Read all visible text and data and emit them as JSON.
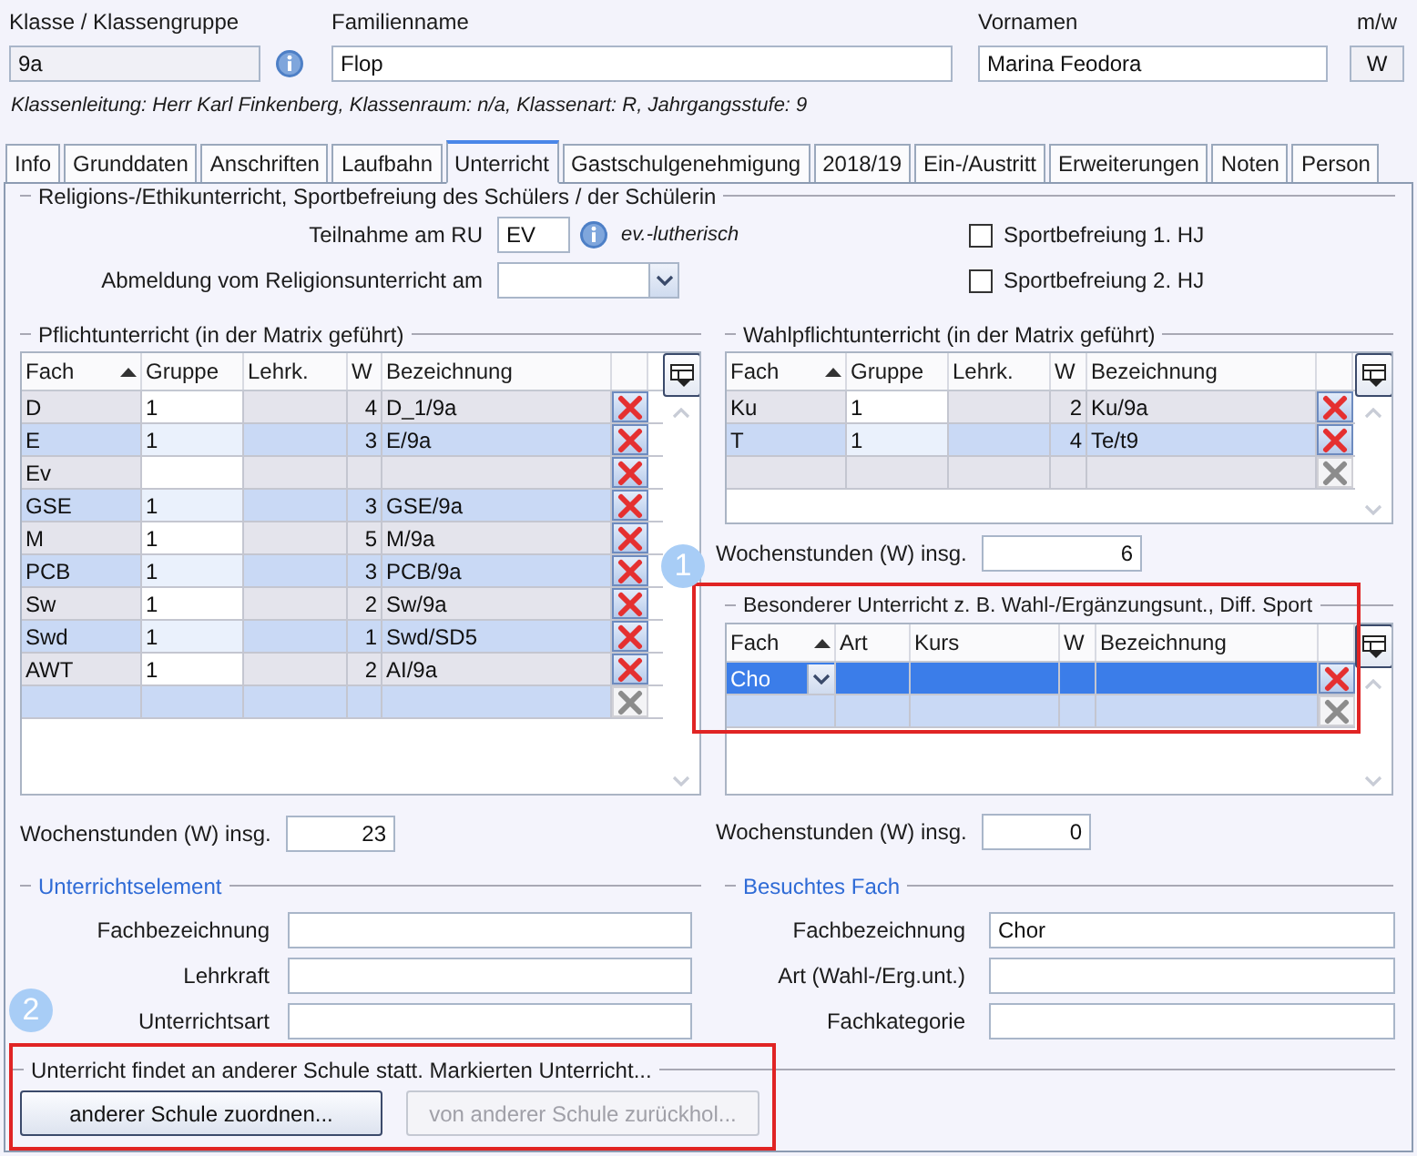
{
  "header": {
    "class_label": "Klasse / Klassengruppe",
    "class_value": "9a",
    "family_label": "Familienname",
    "family_value": "Flop",
    "first_label": "Vornamen",
    "first_value": "Marina Feodora",
    "gender_label": "m/w",
    "gender_value": "W",
    "info": "Klassenleitung: Herr Karl Finkenberg, Klassenraum: n/a, Klassenart: R, Jahrgangsstufe: 9"
  },
  "tabs": [
    {
      "label": "Info",
      "selected": false
    },
    {
      "label": "Grunddaten",
      "selected": false
    },
    {
      "label": "Anschriften",
      "selected": false
    },
    {
      "label": "Laufbahn",
      "selected": false
    },
    {
      "label": "Unterricht",
      "selected": true
    },
    {
      "label": "Gastschulgenehmigung",
      "selected": false
    },
    {
      "label": "2018/19",
      "selected": false
    },
    {
      "label": "Ein-/Austritt",
      "selected": false
    },
    {
      "label": "Erweiterungen",
      "selected": false
    },
    {
      "label": "Noten",
      "selected": false
    },
    {
      "label": "Person",
      "selected": false
    }
  ],
  "religion": {
    "title": "Religions-/Ethikunterricht, Sportbefreiung des Schülers / der Schülerin",
    "ru_label": "Teilnahme am RU",
    "ru_value": "EV",
    "ru_note": "ev.-lutherisch",
    "abmeldung_label": "Abmeldung vom Religionsunterricht am",
    "checkboxes": [
      {
        "label": "Sportbefreiung 1. HJ",
        "checked": false
      },
      {
        "label": "Sportbefreiung 2. HJ",
        "checked": false
      }
    ]
  },
  "pflicht": {
    "title": "Pflichtunterricht (in der Matrix geführt)",
    "columns": [
      "Fach",
      "Gruppe",
      "Lehrk.",
      "W",
      "Bezeichnung"
    ],
    "rows": [
      {
        "kind": "entry",
        "selected": false,
        "fach": "D",
        "gruppe": "1",
        "w": "4",
        "bezeichnung": "D_1/9a"
      },
      {
        "kind": "entry",
        "selected": false,
        "fach": "E",
        "gruppe": "1",
        "w": "3",
        "bezeichnung": "E/9a"
      },
      {
        "kind": "entry",
        "selected": false,
        "fach": "Ev"
      },
      {
        "kind": "entry",
        "selected": false,
        "fach": "GSE",
        "gruppe": "1",
        "w": "3",
        "bezeichnung": "GSE/9a"
      },
      {
        "kind": "entry",
        "selected": false,
        "fach": "M",
        "gruppe": "1",
        "w": "5",
        "bezeichnung": "M/9a"
      },
      {
        "kind": "entry",
        "selected": false,
        "fach": "PCB",
        "gruppe": "1",
        "w": "3",
        "bezeichnung": "PCB/9a"
      },
      {
        "kind": "entry",
        "selected": false,
        "fach": "Sw",
        "gruppe": "1",
        "w": "2",
        "bezeichnung": "Sw/9a"
      },
      {
        "kind": "entry",
        "selected": false,
        "fach": "Swd",
        "gruppe": "1",
        "w": "1",
        "bezeichnung": "Swd/SD5"
      },
      {
        "kind": "entry",
        "selected": false,
        "fach": "AWT",
        "gruppe": "1",
        "w": "2",
        "bezeichnung": "AI/9a"
      },
      {
        "kind": "new",
        "selected": false
      }
    ],
    "total_label": "Wochenstunden (W) insg.",
    "total": "23"
  },
  "wahlpflicht": {
    "title": "Wahlpflichtunterricht (in der Matrix geführt)",
    "columns": [
      "Fach",
      "Gruppe",
      "Lehrk.",
      "W",
      "Bezeichnung"
    ],
    "rows": [
      {
        "kind": "entry",
        "selected": false,
        "fach": "Ku",
        "gruppe": "1",
        "w": "2",
        "bezeichnung": "Ku/9a"
      },
      {
        "kind": "entry",
        "selected": false,
        "fach": "T",
        "gruppe": "1",
        "w": "4",
        "bezeichnung": "Te/t9"
      },
      {
        "kind": "new",
        "selected": false
      }
    ],
    "total_label": "Wochenstunden (W) insg.",
    "total": "6"
  },
  "besonderer": {
    "title": "Besonderer Unterricht z. B. Wahl-/Ergänzungsunt., Diff. Sport",
    "columns": [
      "Fach",
      "Art",
      "Kurs",
      "W",
      "Bezeichnung"
    ],
    "rows": [
      {
        "kind": "entry",
        "selected": true,
        "fach": "Cho"
      },
      {
        "kind": "new",
        "selected": false
      }
    ],
    "total_label": "Wochenstunden (W) insg.",
    "total": "0"
  },
  "unterrichtselement": {
    "title": "Unterrichtselement",
    "fields": [
      {
        "label": "Fachbezeichnung"
      },
      {
        "label": "Lehrkraft"
      },
      {
        "label": "Unterrichtsart"
      }
    ]
  },
  "besuchtes_fach": {
    "title": "Besuchtes Fach",
    "fields": [
      {
        "label": "Fachbezeichnung",
        "value": "Chor"
      },
      {
        "label": "Art (Wahl-/Erg.unt.)"
      },
      {
        "label": "Fachkategorie"
      }
    ]
  },
  "andere_schule": {
    "title": "Unterricht findet an anderer Schule statt. Markierten Unterricht...",
    "buttons": [
      {
        "label": "anderer Schule zuordnen...",
        "disabled": false
      },
      {
        "label": "von anderer Schule zurückhol...",
        "disabled": true
      }
    ]
  },
  "callouts": [
    {
      "number": "1"
    },
    {
      "number": "2"
    }
  ]
}
